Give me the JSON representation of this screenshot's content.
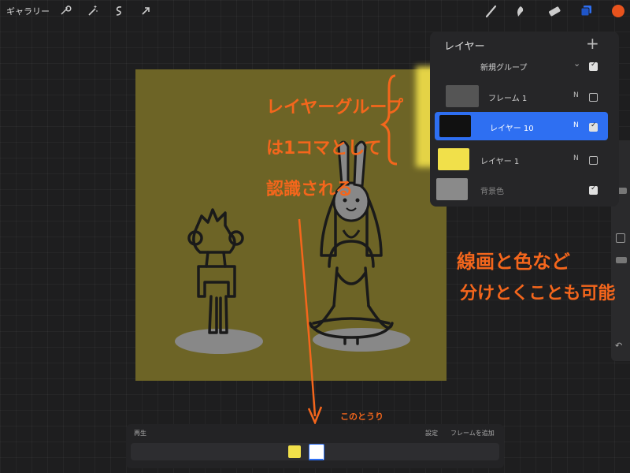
{
  "topbar": {
    "gallery_label": "ギャラリー",
    "left_tools": [
      "wrench-icon",
      "magic-wand-icon",
      "selection-icon",
      "transform-arrow-icon"
    ],
    "right_tools": [
      "brush-icon",
      "smudge-icon",
      "eraser-icon",
      "layers-icon",
      "color-swatch"
    ],
    "accent_color": "#e8531d",
    "layers_active_color": "#2e6ff2"
  },
  "layers_panel": {
    "title": "レイヤー",
    "add_label": "+",
    "rows": [
      {
        "name": "新規グループ",
        "mode": "",
        "visible": true,
        "type": "group"
      },
      {
        "name": "フレーム 1",
        "mode": "N",
        "visible": false,
        "type": "layer"
      },
      {
        "name": "レイヤー 10",
        "mode": "N",
        "visible": true,
        "type": "layer",
        "selected": true
      },
      {
        "name": "レイヤー 1",
        "mode": "N",
        "visible": false,
        "type": "layer"
      },
      {
        "name": "背景色",
        "mode": "",
        "visible": true,
        "type": "background"
      }
    ],
    "selected_color": "#2e6ff2"
  },
  "annotations": {
    "group_note_1": "レイヤーグループ",
    "group_note_2": "は1コマとして",
    "group_note_3": "認識される",
    "split_note_1": "線画と色など",
    "split_note_2": "分けとくことも可能",
    "frame_note": "このとうり",
    "color": "#f4661c"
  },
  "timeline": {
    "play_label": "再生",
    "settings_label": "設定",
    "add_frame_label": "フレームを追加"
  },
  "canvas": {
    "background_color": "#6d6426",
    "highlight_color": "#f1e04a"
  }
}
